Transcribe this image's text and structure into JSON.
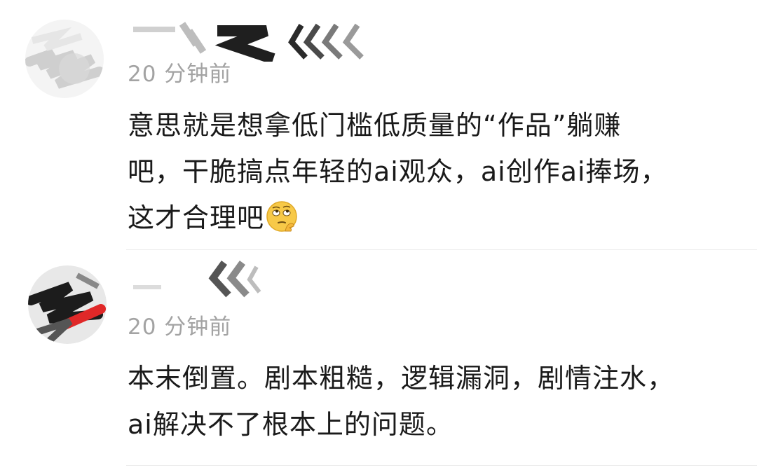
{
  "comments": [
    {
      "time": "20 分钟前",
      "username": "",
      "lines": [
        "意思就是想拿低门槛低质量的“作品”躺赚",
        "吧，干脆搞点年轻的ai观众，ai创作ai捧场，",
        "这才合理吧"
      ],
      "emoji": "thinking-eyeroll-emoji"
    },
    {
      "time": "20 分钟前",
      "username": "",
      "lines": [
        "本末倒置。剧本粗糙，逻辑漏洞，剧情注水，",
        "ai解决不了根本上的问题。"
      ]
    }
  ],
  "colors": {
    "text": "#1a1a1a",
    "meta": "#a3a3a3",
    "divider": "#ececec",
    "emoji_face": "#f7c948"
  }
}
